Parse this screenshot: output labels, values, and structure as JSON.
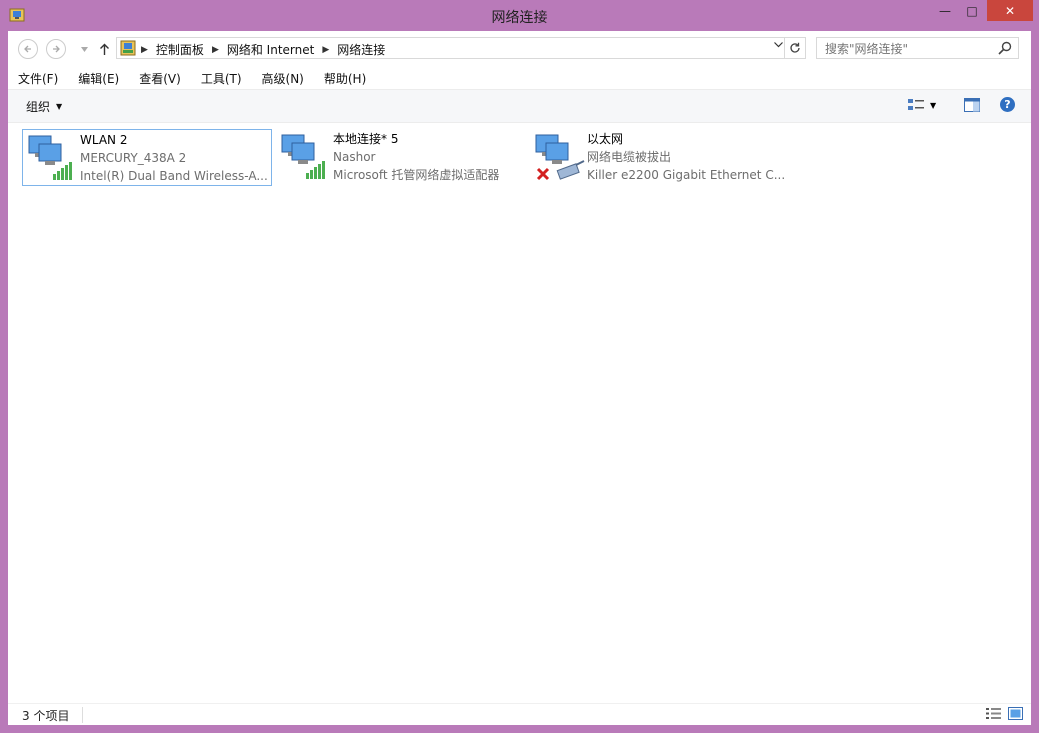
{
  "window": {
    "title": "网络连接",
    "min_glyph": "—",
    "max_glyph": "□",
    "close_glyph": "✕"
  },
  "addressbar": {
    "breadcrumbs": [
      "控制面板",
      "网络和 Internet",
      "网络连接"
    ],
    "search_placeholder": "搜索\"网络连接\""
  },
  "menu": [
    "文件(F)",
    "编辑(E)",
    "查看(V)",
    "工具(T)",
    "高级(N)",
    "帮助(H)"
  ],
  "toolbar": {
    "organize_label": "组织",
    "help_label": "?"
  },
  "connections": [
    {
      "name": "WLAN 2",
      "status": "MERCURY_438A  2",
      "device": "Intel(R) Dual Band Wireless-A...",
      "icon": "wifi-signal-icon",
      "selected": true
    },
    {
      "name": "本地连接* 5",
      "status": "Nashor",
      "device": "Microsoft 托管网络虚拟适配器",
      "icon": "wifi-signal-icon",
      "selected": false
    },
    {
      "name": "以太网",
      "status": "网络电缆被拔出",
      "device": "Killer e2200 Gigabit Ethernet C...",
      "icon": "ethernet-disconnected-icon",
      "selected": false
    }
  ],
  "status": {
    "count_text": "3 个项目"
  },
  "colors": {
    "frame": "#b97ab9",
    "close": "#c9463d",
    "selection_border": "#7eb4ea"
  }
}
